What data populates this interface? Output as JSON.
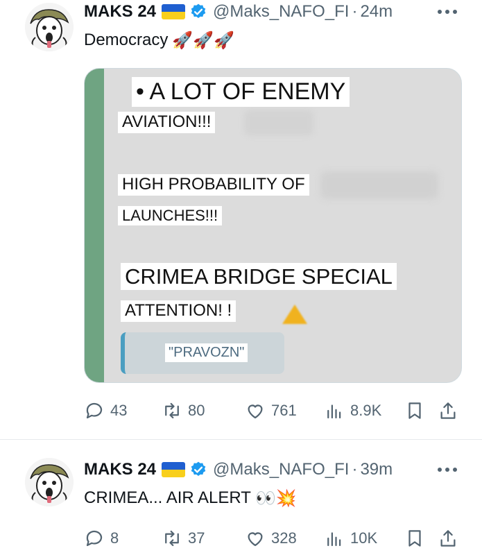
{
  "tweets": [
    {
      "author": "MAKS 24",
      "handle": "@Maks_NAFO_FI",
      "separator": "·",
      "time": "24m",
      "text": "Democracy",
      "emojis": "🚀🚀🚀",
      "media": {
        "lines": [
          "• A LOT OF ENEMY",
          "AVIATION!!!",
          "HIGH PROBABILITY OF",
          "LAUNCHES!!!",
          "CRIMEA BRIDGE SPECIAL",
          "ATTENTION! !"
        ],
        "button": "\"PRAVOZN\""
      },
      "stats": {
        "replies": "43",
        "retweets": "80",
        "likes": "761",
        "views": "8.9K"
      }
    },
    {
      "author": "MAKS 24",
      "handle": "@Maks_NAFO_FI",
      "separator": "·",
      "time": "39m",
      "text": "CRIMEA... AIR ALERT",
      "emojis": "👀💥",
      "stats": {
        "replies": "8",
        "retweets": "37",
        "likes": "328",
        "views": "10K"
      }
    }
  ],
  "colors": {
    "flag_blue": "#1f5fd0",
    "flag_yellow": "#f8cf1c",
    "verified": "#1d9bf0",
    "secondary_text": "#536471"
  },
  "icons": [
    "avatar-image",
    "ukraine-flag-icon",
    "verified-badge-icon",
    "more-icon",
    "reply-icon",
    "retweet-icon",
    "like-icon",
    "views-icon",
    "bookmark-icon",
    "share-icon"
  ]
}
